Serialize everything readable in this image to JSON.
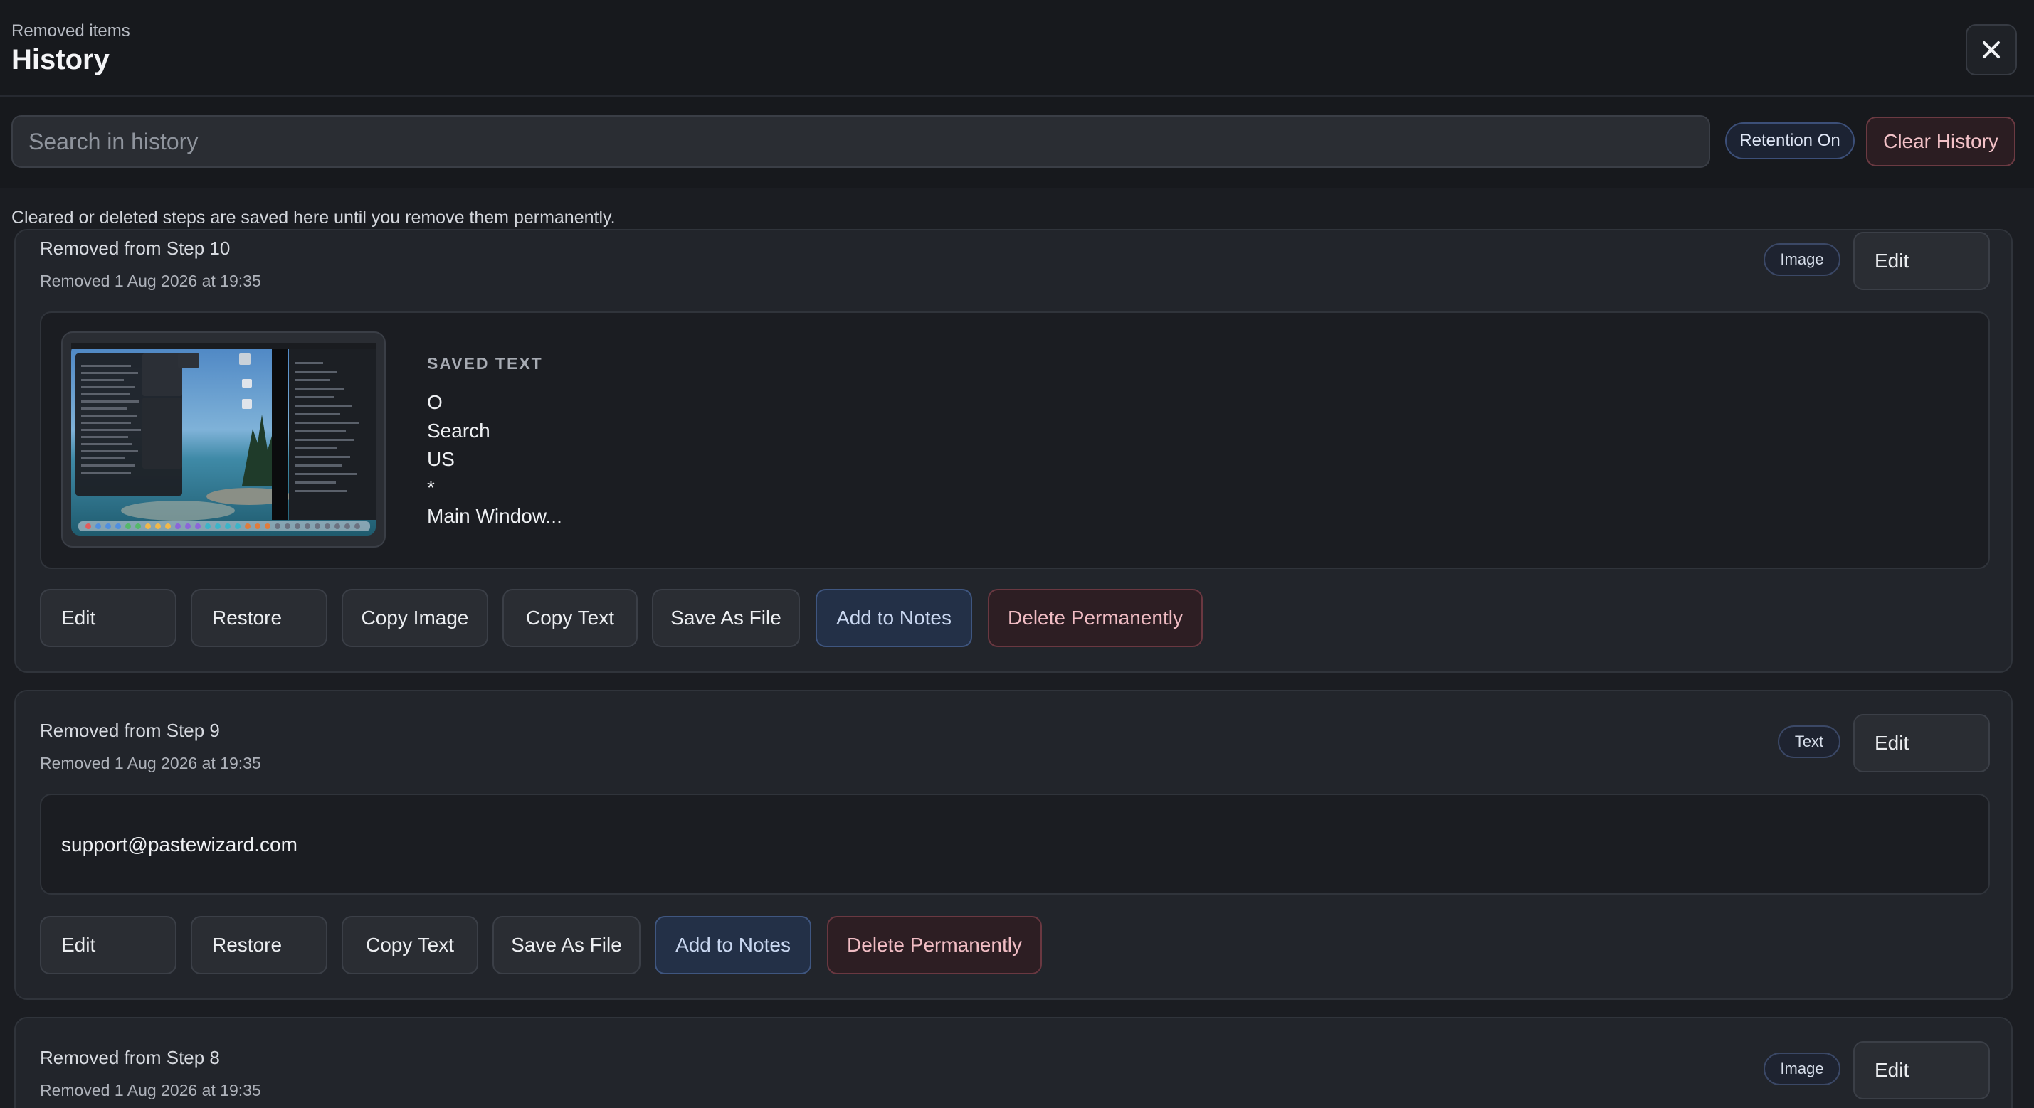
{
  "header": {
    "eyebrow": "Removed items",
    "title": "History"
  },
  "toolbar": {
    "search_placeholder": "Search in history",
    "retention_label": "Retention On",
    "clear_label": "Clear History"
  },
  "note": "Cleared or deleted steps are saved here until you remove them permanently.",
  "items": [
    {
      "origin": "Removed from Step 10",
      "removed_at": "Removed 1 Aug 2026 at 19:35",
      "kind": "Image",
      "edit_label": "Edit",
      "saved_text_label": "SAVED TEXT",
      "saved_text_lines": [
        "O",
        "Search",
        "US",
        "*",
        "Main Window..."
      ],
      "actions": [
        "Edit",
        "Restore",
        "Copy Image",
        "Copy Text",
        "Save As File",
        "Add to Notes",
        "Delete Permanently"
      ]
    },
    {
      "origin": "Removed from Step 9",
      "removed_at": "Removed 1 Aug 2026 at 19:35",
      "kind": "Text",
      "edit_label": "Edit",
      "text_value": "support@pastewizard.com",
      "actions": [
        "Edit",
        "Restore",
        "Copy Text",
        "Save As File",
        "Add to Notes",
        "Delete Permanently"
      ]
    },
    {
      "origin": "Removed from Step 8",
      "removed_at": "Removed 1 Aug 2026 at 19:35",
      "kind": "Image",
      "edit_label": "Edit"
    }
  ],
  "colors": {
    "background": "#1b1d22",
    "card": "#22252b",
    "accent_blue": "#3f5680",
    "danger": "#6a3841"
  },
  "icons": {
    "close": "close-icon",
    "thumbnail": "screenshot-thumbnail"
  }
}
